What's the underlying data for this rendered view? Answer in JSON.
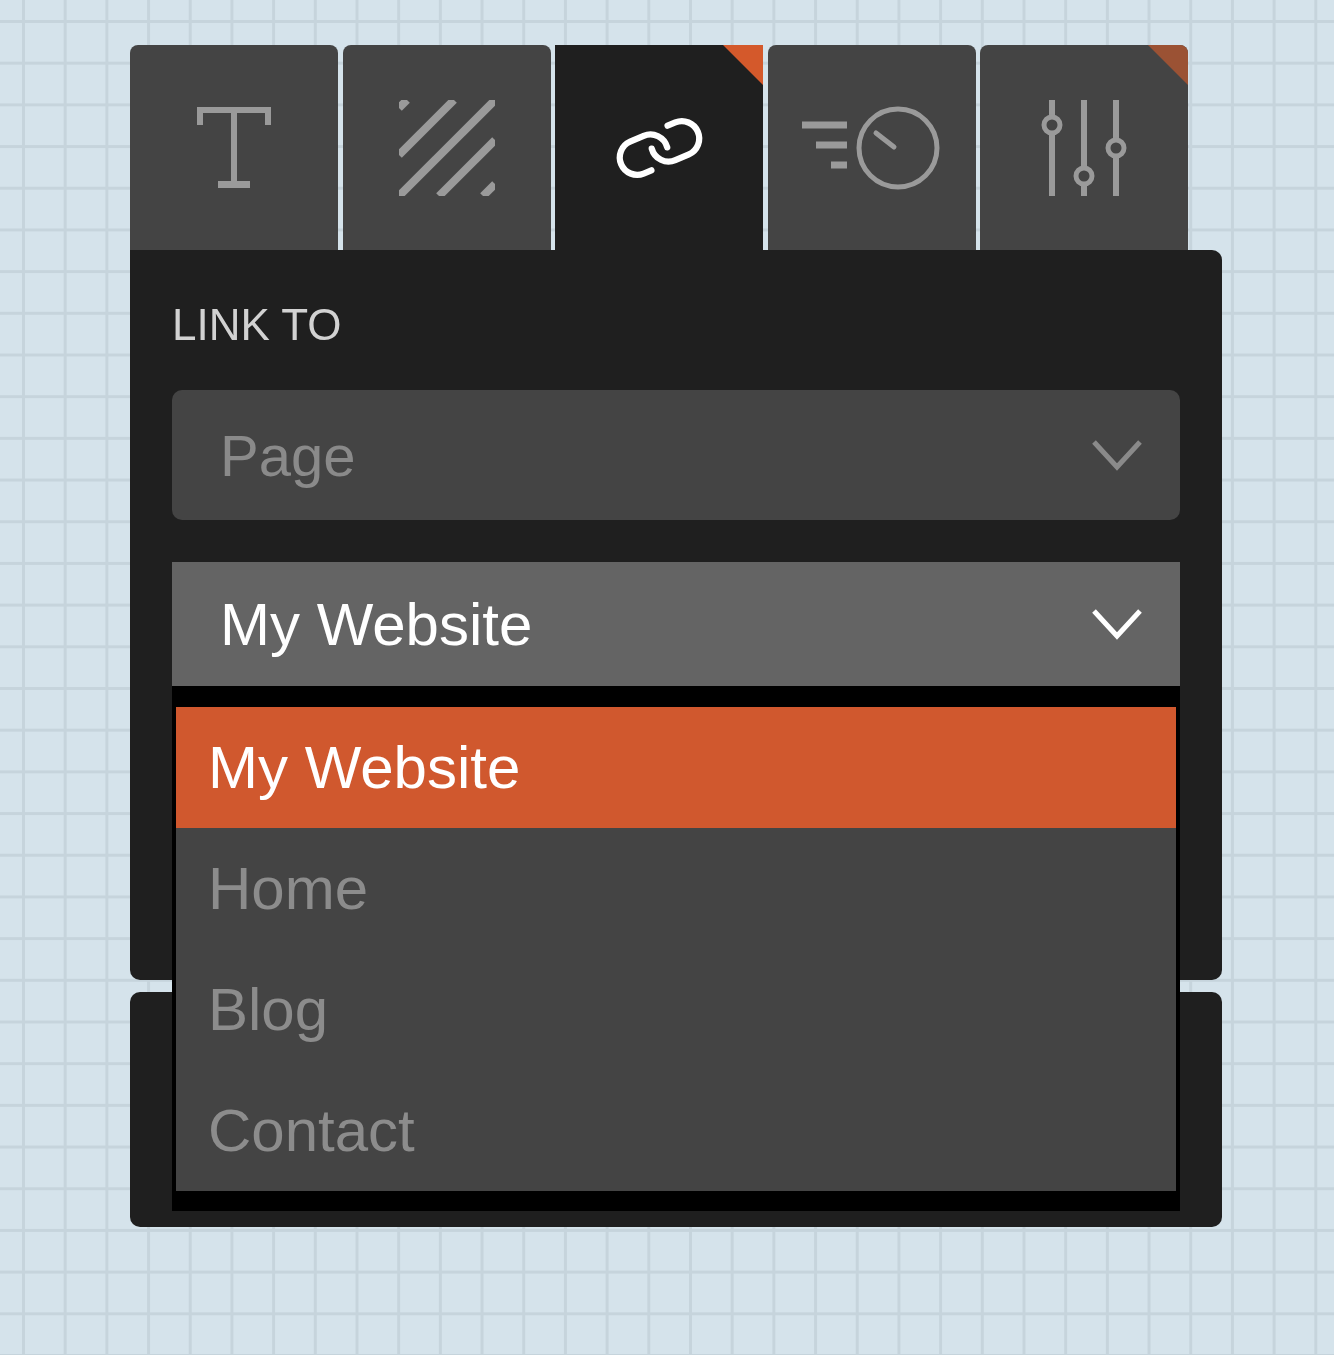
{
  "tabs": [
    {
      "selected": false,
      "marked": false
    },
    {
      "selected": false,
      "marked": false
    },
    {
      "selected": true,
      "marked": true
    },
    {
      "selected": false,
      "marked": false
    },
    {
      "selected": false,
      "marked": true
    }
  ],
  "panel": {
    "label": "LINK TO",
    "selects": [
      {
        "value": "Page",
        "expanded": false
      },
      {
        "value": "My Website",
        "expanded": true,
        "options": [
          {
            "label": "My Website",
            "selected": true
          },
          {
            "label": "Home",
            "selected": false
          },
          {
            "label": "Blog",
            "selected": false
          },
          {
            "label": "Contact",
            "selected": false
          }
        ]
      }
    ]
  }
}
